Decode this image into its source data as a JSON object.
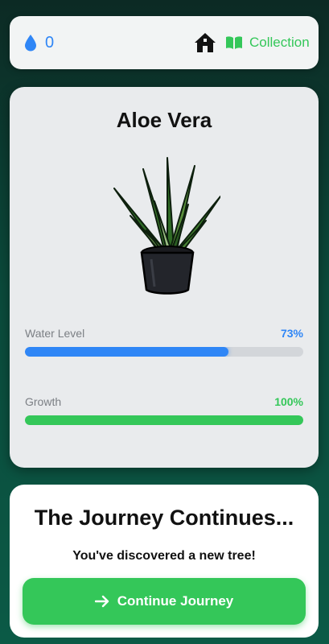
{
  "header": {
    "water_drops": "0",
    "home_icon": "house-icon",
    "collection_icon": "book-icon",
    "collection_label": "Collection"
  },
  "plant": {
    "name": "Aloe Vera",
    "image_icon": "aloe-vera-plant-illustration",
    "water": {
      "label": "Water Level",
      "value": "73%",
      "level": 0.73,
      "color": "#2f86f6"
    },
    "growth": {
      "label": "Growth",
      "value": "100%",
      "level": 1.0,
      "color": "#34c759"
    }
  },
  "journey": {
    "title": "The Journey Continues...",
    "subtitle": "You've discovered a new tree!",
    "button_icon": "arrow-right-icon",
    "button_label": "Continue Journey"
  }
}
